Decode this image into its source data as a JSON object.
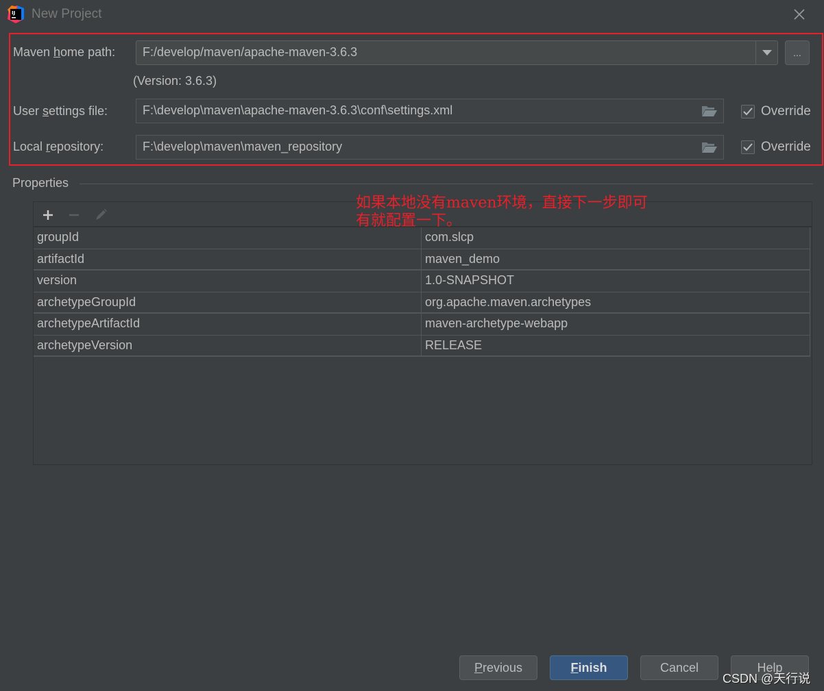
{
  "window": {
    "title": "New Project",
    "logo": "intellij-idea-icon"
  },
  "maven": {
    "home_path_label_pre": "Maven ",
    "home_path_label_mnemonic": "h",
    "home_path_label_post": "ome path:",
    "home_path_value": "F:/develop/maven/apache-maven-3.6.3",
    "browse_label": "...",
    "version_text": "(Version: 3.6.3)",
    "settings_label_pre": "User ",
    "settings_label_mnemonic": "s",
    "settings_label_post": "ettings file:",
    "settings_value": "F:\\develop\\maven\\apache-maven-3.6.3\\conf\\settings.xml",
    "settings_override_label": "Override",
    "settings_override_checked": true,
    "repo_label_pre": "Local ",
    "repo_label_mnemonic": "r",
    "repo_label_post": "epository:",
    "repo_value": "F:\\develop\\maven\\maven_repository",
    "repo_override_label": "Override",
    "repo_override_checked": true
  },
  "properties": {
    "title": "Properties",
    "toolbar": [
      "add-icon",
      "remove-icon",
      "edit-icon"
    ],
    "rows": [
      {
        "key": "groupId",
        "value": "com.slcp"
      },
      {
        "key": "artifactId",
        "value": "maven_demo"
      },
      {
        "key": "version",
        "value": "1.0-SNAPSHOT"
      },
      {
        "key": "archetypeGroupId",
        "value": "org.apache.maven.archetypes"
      },
      {
        "key": "archetypeArtifactId",
        "value": "maven-archetype-webapp"
      },
      {
        "key": "archetypeVersion",
        "value": "RELEASE"
      }
    ]
  },
  "annotation": {
    "line1": "如果本地没有maven环境，直接下一步即可",
    "line2": "有就配置一下。",
    "color": "#e8202a"
  },
  "footer": {
    "previous_mnemonic": "P",
    "previous_rest": "revious",
    "finish_mnemonic": "F",
    "finish_rest": "inish",
    "cancel": "Cancel",
    "help": "Help"
  },
  "watermark": "CSDN @天行说",
  "colors": {
    "background": "#3c3f41",
    "highlight": "#e8202a",
    "primary_button": "#365880"
  }
}
